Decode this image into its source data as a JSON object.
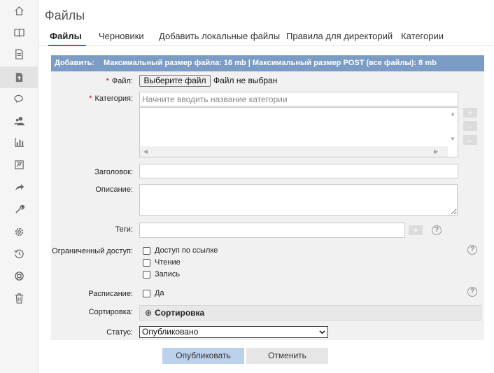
{
  "sidebar": {
    "icons": [
      "home-icon",
      "book-icon",
      "document-icon",
      "file-upload-icon",
      "comments-icon",
      "users-icon",
      "chart-icon",
      "newsletter-icon",
      "share-icon",
      "tools-icon",
      "settings-icon",
      "history-icon",
      "help-lifebuoy-icon",
      "trash-icon"
    ],
    "active_index": 3
  },
  "page": {
    "title": "Файлы"
  },
  "tabs": [
    {
      "label": "Файлы",
      "active": true
    },
    {
      "label": "Черновики"
    },
    {
      "label": "Добавить локальные файлы"
    },
    {
      "label": "Правила для директорий"
    },
    {
      "label": "Категории"
    }
  ],
  "form": {
    "header_label": "Добавить:",
    "header_info": "Максимальный размер файла: 16 mb | Максимальный размер POST (все файлы): 8 mb",
    "file": {
      "label": "Файл:",
      "required_mark": "*",
      "button_label": "Выберите файл",
      "status": "Файл не выбран"
    },
    "category": {
      "label": "Категория:",
      "required_mark": "*",
      "placeholder": "Начните вводить название категории",
      "add_symbol": "+",
      "remove_symbol": "-",
      "back_symbol": "←"
    },
    "heading": {
      "label": "Заголовок:",
      "value": ""
    },
    "description": {
      "label": "Описание:",
      "value": ""
    },
    "tags": {
      "label": "Теги:",
      "value": "",
      "add_symbol": "+"
    },
    "restricted_access": {
      "label": "Ограниченный доступ:",
      "options": [
        {
          "label": "Доступ по ссылке",
          "checked": false
        },
        {
          "label": "Чтение",
          "checked": false
        },
        {
          "label": "Запись",
          "checked": false
        }
      ]
    },
    "schedule": {
      "label": "Расписание:",
      "option": "Да",
      "checked": false
    },
    "sorting": {
      "label": "Сортировка:",
      "expand_symbol": "⊕",
      "section_title": "Сортировка"
    },
    "status": {
      "label": "Статус:",
      "selected": "Опубликовано"
    },
    "help_symbol": "?",
    "submit_label": "Опубликовать",
    "cancel_label": "Отменить"
  }
}
